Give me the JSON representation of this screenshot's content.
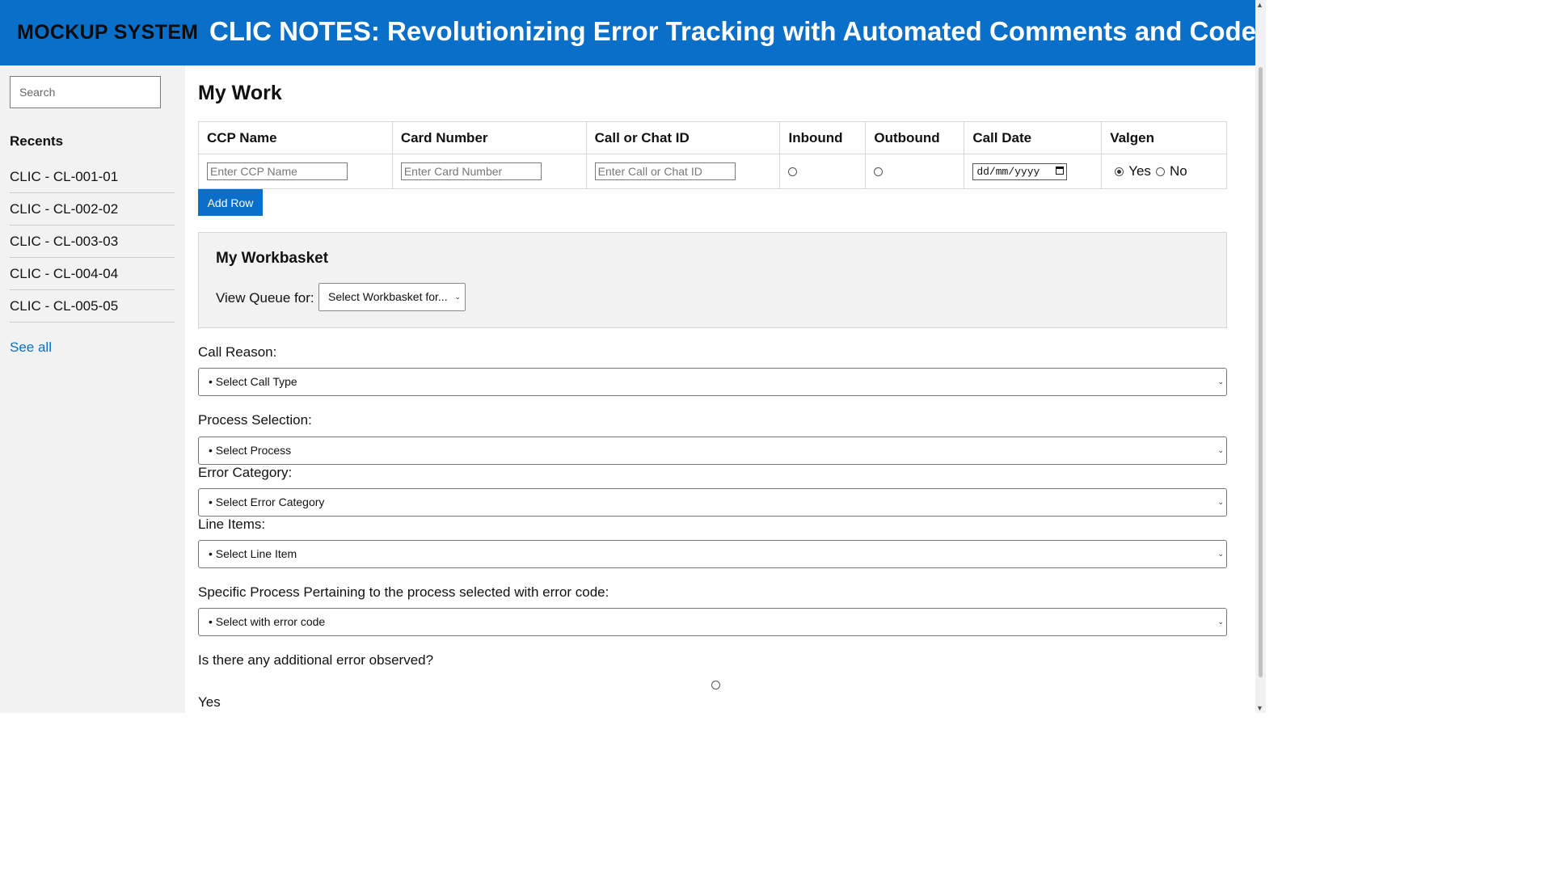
{
  "header": {
    "brand": "MOCKUP SYSTEM",
    "title": "CLIC NOTES: Revolutionizing Error Tracking with Automated Comments and Codes"
  },
  "sidebar": {
    "search_placeholder": "Search",
    "recents_title": "Recents",
    "recents": [
      {
        "label": "CLIC - CL-001-01"
      },
      {
        "label": "CLIC - CL-002-02"
      },
      {
        "label": "CLIC - CL-003-03"
      },
      {
        "label": "CLIC - CL-004-04"
      },
      {
        "label": "CLIC - CL-005-05"
      }
    ],
    "see_all": "See all"
  },
  "main": {
    "title": "My Work",
    "table": {
      "headers": [
        "CCP Name",
        "Card Number",
        "Call or Chat ID",
        "Inbound",
        "Outbound",
        "Call Date",
        "Valgen"
      ],
      "ccp_placeholder": "Enter CCP Name",
      "card_placeholder": "Enter Card Number",
      "call_id_placeholder": "Enter Call or Chat ID",
      "inbound_checked": false,
      "outbound_checked": false,
      "date_placeholder": "dd/mm/yyyy",
      "valgen_yes": "Yes",
      "valgen_no": "No",
      "valgen_selected": "Yes"
    },
    "add_row": "Add Row",
    "workbasket": {
      "title": "My Workbasket",
      "view_label": "View Queue for:",
      "select_value": "Select Workbasket for..."
    },
    "call_reason": {
      "label": "Call Reason:",
      "value": "• Select Call Type"
    },
    "process_selection": {
      "label": "Process Selection:",
      "value": "• Select Process"
    },
    "error_category": {
      "label": "Error Category:",
      "value": "• Select Error Category"
    },
    "line_items": {
      "label": "Line Items:",
      "value": "• Select Line Item"
    },
    "specific_process": {
      "label": "Specific Process Pertaining to the process selected with error code:",
      "value": "• Select with error code"
    },
    "additional_error": {
      "question": "Is there any additional error observed?",
      "yes_label": "Yes"
    }
  },
  "colors": {
    "accent": "#0a6fc9",
    "sidebar_bg": "#f2f2f2"
  }
}
